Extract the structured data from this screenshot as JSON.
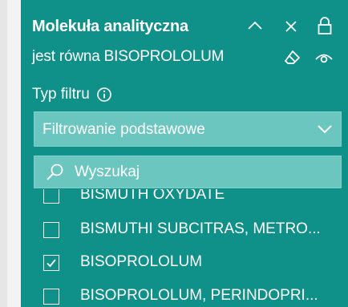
{
  "slicer": {
    "title": "Molekuła analityczna",
    "subtitle": "jest równa BISOPROLOLUM",
    "filter_type_label": "Typ filtru",
    "filter_mode": "Filtrowanie podstawowe",
    "search_placeholder": "Wyszukaj",
    "items": [
      {
        "label": "BISMUTH OXYDATE",
        "checked": false
      },
      {
        "label": "BISMUTHI SUBCITRAS, METRO...",
        "checked": false
      },
      {
        "label": "BISOPROLOLUM",
        "checked": true
      },
      {
        "label": "BISOPROLOLUM, PERINDOPRI...",
        "checked": false
      }
    ]
  },
  "colors": {
    "panel_bg": "#0f9089",
    "input_bg": "#6bc6c0",
    "text": "#ffffff"
  },
  "icons": {
    "header": [
      "chevron-up-icon",
      "close-icon",
      "lock-icon",
      "eraser-icon",
      "eye-icon"
    ],
    "info": "info-icon",
    "dropdown": "chevron-down-icon",
    "search": "search-icon",
    "checkbox": "checkmark-icon"
  }
}
